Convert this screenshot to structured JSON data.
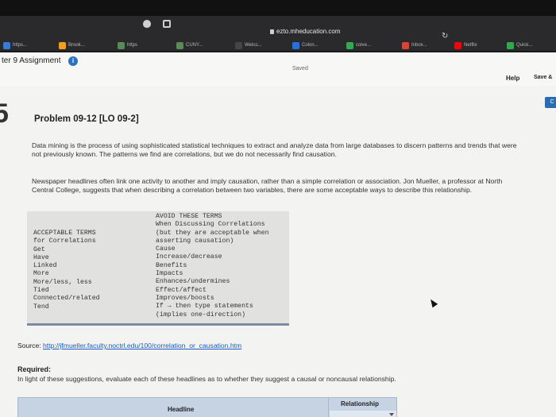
{
  "browser": {
    "address": "ezto.mheducation.com",
    "bookmarks": [
      {
        "label": "https...",
        "color": "#3a7bd5"
      },
      {
        "label": "Brook...",
        "color": "#f0a020"
      },
      {
        "label": "https",
        "color": "#5a8a5a"
      },
      {
        "label": "CUNY...",
        "color": "#5a8a5a"
      },
      {
        "label": "Welco...",
        "color": "#444444"
      },
      {
        "label": "Colon...",
        "color": "#2a6fd6"
      },
      {
        "label": "colve...",
        "color": "#34a853"
      },
      {
        "label": "Inbox...",
        "color": "#d44638"
      },
      {
        "label": "Netflix",
        "color": "#e50914"
      },
      {
        "label": "Quick...",
        "color": "#2fa84f"
      }
    ]
  },
  "app": {
    "assignment_title": "ter 9 Assignment",
    "saved": "Saved",
    "help": "Help",
    "save_exit": "Save &",
    "side_button": "C",
    "question_digit": "5"
  },
  "problem": {
    "title": "Problem 09-12 [LO 09-2]",
    "paragraph1": "Data mining is the process of using sophisticated statistical techniques to extract and analyze data from large databases to discern patterns and trends that were not previously known. The patterns we find are correlations, but we do not necessarily find causation.",
    "paragraph2": "Newspaper headlines often link one activity to another and imply causation, rather than a simple correlation or association. Jon Mueller, a professor at North Central College, suggests that when describing a correlation between two variables, there are some acceptable ways to describe this relationship."
  },
  "terms": {
    "acceptable_header": [
      "ACCEPTABLE TERMS",
      "for Correlations"
    ],
    "acceptable": [
      "Get",
      "Have",
      "Linked",
      "More",
      "More/less, less",
      "Tied",
      "Connected/related",
      "Tend"
    ],
    "avoid_header": [
      "AVOID THESE TERMS",
      "When Discussing Correlations",
      "(but they are acceptable when",
      "asserting causation)"
    ],
    "avoid": [
      "Cause",
      "Increase/decrease",
      "Benefits",
      "Impacts",
      "Enhances/undermines",
      "Effect/affect",
      "Improves/boosts",
      "If → then type statements",
      "(implies one-direction)"
    ]
  },
  "source": {
    "label": "Source: ",
    "url": "http://jfmueller.faculty.noctrl.edu/100/correlation_or_causation.htm"
  },
  "required": {
    "label": "Required:",
    "text": "In light of these suggestions, evaluate each of these headlines as to whether they suggest a causal or noncausal relationship."
  },
  "answer_table": {
    "headline_header": "Headline",
    "relationship_header": "Relationship"
  }
}
